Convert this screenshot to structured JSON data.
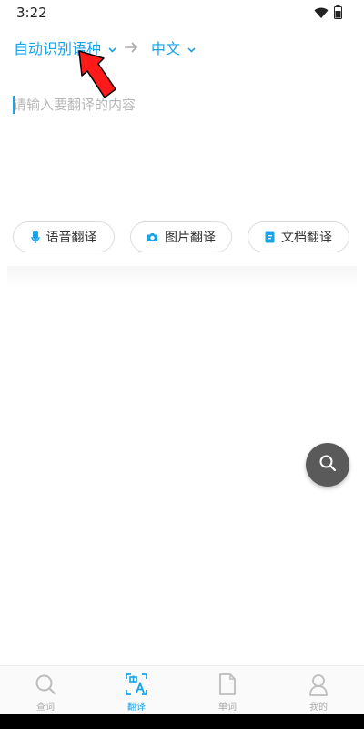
{
  "status_bar": {
    "time": "3:22"
  },
  "language_bar": {
    "source_lang": "自动识别语种",
    "target_lang": "中文"
  },
  "input": {
    "placeholder": "请输入要翻译的内容"
  },
  "actions": [
    {
      "label": "语音翻译",
      "icon": "microphone-icon"
    },
    {
      "label": "图片翻译",
      "icon": "camera-icon"
    },
    {
      "label": "文档翻译",
      "icon": "document-icon"
    }
  ],
  "bottom_nav": [
    {
      "label": "查词",
      "icon": "search-icon",
      "active": false
    },
    {
      "label": "翻译",
      "icon": "translate-icon",
      "active": true
    },
    {
      "label": "单词",
      "icon": "file-icon",
      "active": false
    },
    {
      "label": "我的",
      "icon": "user-icon",
      "active": false
    }
  ],
  "colors": {
    "accent": "#1aa3e8",
    "annotation_arrow": "#ff1a1a",
    "fab": "#5a5a5a",
    "inactive": "#aaaaaa"
  }
}
